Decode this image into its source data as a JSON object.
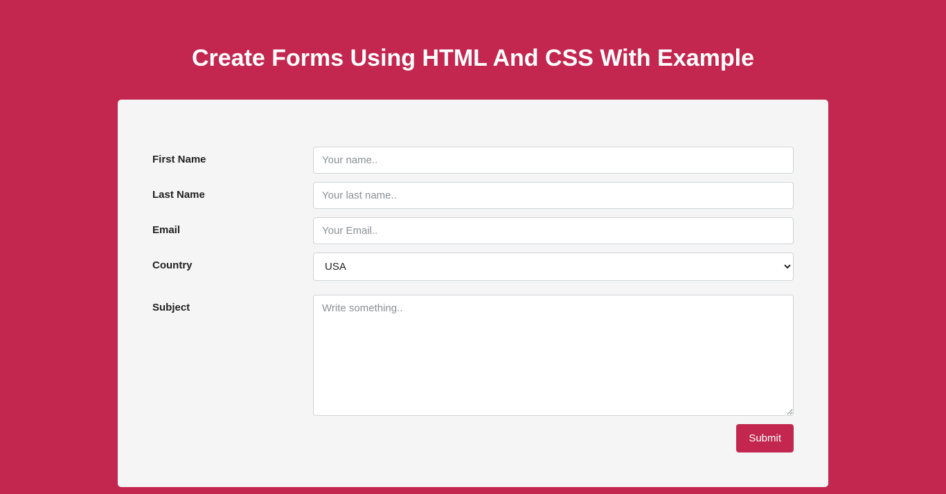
{
  "title": "Create Forms Using HTML And CSS With Example",
  "form": {
    "firstName": {
      "label": "First Name",
      "placeholder": "Your name..",
      "value": ""
    },
    "lastName": {
      "label": "Last Name",
      "placeholder": "Your last name..",
      "value": ""
    },
    "email": {
      "label": "Email",
      "placeholder": "Your Email..",
      "value": ""
    },
    "country": {
      "label": "Country",
      "selected": "USA"
    },
    "subject": {
      "label": "Subject",
      "placeholder": "Write something..",
      "value": ""
    },
    "submit": {
      "label": "Submit"
    }
  }
}
